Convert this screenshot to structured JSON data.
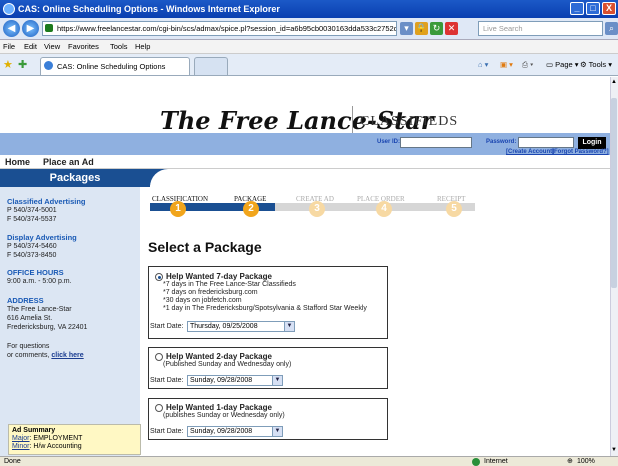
{
  "window": {
    "title": "CAS: Online Scheduling Options - Windows Internet Explorer",
    "url": "https://www.freelancestar.com/cgi-bin/scs/admax/spice.pl?session_id=a6b95cb0030163dda533c2752c4c3d51&form_",
    "search_placeholder": "Live Search",
    "tab_label": "CAS: Online Scheduling Options",
    "minimize": "_",
    "maximize": "□",
    "close": "X"
  },
  "menu": [
    "File",
    "Edit",
    "View",
    "Favorites",
    "Tools",
    "Help"
  ],
  "commandbar": {
    "page": "Page",
    "tools": "Tools"
  },
  "header": {
    "logo_text": "The Free Lance-Star",
    "section": "CLASSIFIEDS",
    "user_id_label": "User ID:",
    "password_label": "Password:",
    "login_button": "Login",
    "create_account": "[Create Account]",
    "forgot_password": "[Forgot Password?]"
  },
  "nav": {
    "home": "Home",
    "place_ad": "Place an Ad"
  },
  "section_title": "Packages",
  "sidebar": {
    "classified_title": "Classified Advertising",
    "classified_phone": "P 540/374-5001",
    "classified_fax": "F 540/374-5537",
    "display_title": "Display Advertising",
    "display_phone": "P 540/374-5460",
    "display_fax": "F 540/373-8450",
    "hours_title": "OFFICE HOURS",
    "hours": "9:00 a.m. - 5:00 p.m.",
    "address_title": "ADDRESS",
    "address1": "The Free Lance-Star",
    "address2": "616 Amelia St.",
    "address3": "Fredericksburg, VA 22401",
    "questions1": "For questions",
    "questions2": "or comments,",
    "click_here": "click here"
  },
  "steps": [
    {
      "label": "CLASSIFICATION",
      "num": "1"
    },
    {
      "label": "PACKAGE",
      "num": "2"
    },
    {
      "label": "CREATE AD",
      "num": "3"
    },
    {
      "label": "PLACE ORDER",
      "num": "4"
    },
    {
      "label": "RECEIPT",
      "num": "5"
    }
  ],
  "main": {
    "heading": "Select a Package",
    "start_date_label": "Start Date:",
    "packages": [
      {
        "title": "Help Wanted 7-day Package",
        "lines": [
          "*7 days in The Free Lance-Star Classifieds",
          "*7 days on fredericksburg.com",
          "*30 days on jobfetch.com",
          "*1 day in The Fredericksburg/Spotsylvania & Stafford Star Weekly"
        ],
        "start_date": "Thursday, 09/25/2008",
        "selected": true
      },
      {
        "title": "Help Wanted 2-day Package",
        "lines": [
          "(Published Sunday and Wednesday only)"
        ],
        "start_date": "Sunday, 09/28/2008",
        "selected": false
      },
      {
        "title": "Help Wanted 1-day Package",
        "lines": [
          "(publishes Sunday or Wednesday only)"
        ],
        "start_date": "Sunday, 09/28/2008",
        "selected": false
      }
    ]
  },
  "ad_summary": {
    "title": "Ad Summary",
    "major_label": "Major",
    "major_value": ": EMPLOYMENT",
    "minor_label": "Minor",
    "minor_value": ": H/w Accounting"
  },
  "status": {
    "left": "Done",
    "zone": "Internet",
    "zoom": "100%"
  }
}
